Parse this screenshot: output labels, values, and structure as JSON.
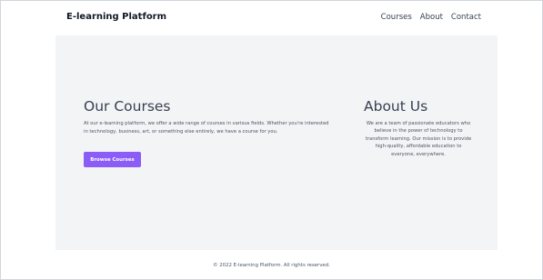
{
  "header": {
    "brand": "E-learning Platform",
    "nav": [
      {
        "label": "Courses"
      },
      {
        "label": "About"
      },
      {
        "label": "Contact"
      }
    ]
  },
  "courses_section": {
    "title": "Our Courses",
    "description": "At our e-learning platform, we offer a wide range of courses in various fields. Whether you're interested in technology, business, art, or something else entirely, we have a course for you.",
    "button_label": "Browse Courses"
  },
  "about_section": {
    "title": "About Us",
    "description": "We are a team of passionate educators who believe in the power of technology to transform learning. Our mission is to provide high-quality, affordable education to everyone, everywhere."
  },
  "footer": {
    "text": "© 2022 E-learning Platform. All rights reserved."
  },
  "colors": {
    "accent": "#8b5cf6",
    "main_background": "#f3f4f6"
  }
}
